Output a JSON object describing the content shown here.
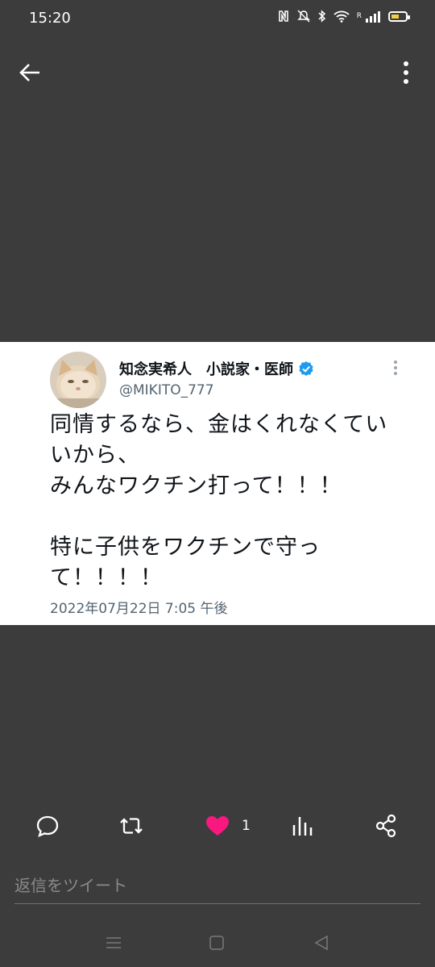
{
  "status_bar": {
    "time": "15:20",
    "icons": [
      "nfc-icon",
      "mute-icon",
      "bluetooth-icon",
      "wifi-icon",
      "roaming-label",
      "signal-icon",
      "battery-icon"
    ],
    "roaming_label": "R",
    "battery_color": "#f4d03f"
  },
  "top_bar": {
    "back_icon": "arrow-left-icon",
    "more_icon": "more-vertical-icon"
  },
  "tweet": {
    "display_name": "知念実希人　小説家・医師",
    "verified": true,
    "verified_color": "#1d9bf0",
    "handle": "@MIKITO_777",
    "text": "同情するなら、金はくれなくてい\nいから、\nみんなワクチン打って！！！\n\n特に子供をワクチンで守っ\nて！！！！",
    "date": "2022年07月22日 7:05 午後"
  },
  "actions": {
    "reply_icon": "comment-icon",
    "retweet_icon": "retweet-icon",
    "like_icon": "heart-icon",
    "like_color": "#f91880",
    "like_count": "1",
    "stats_icon": "stats-icon",
    "share_icon": "share-icon"
  },
  "reply_box": {
    "placeholder": "返信をツイート"
  },
  "nav_bar": {
    "icons": [
      "recents-icon",
      "home-icon",
      "back-icon"
    ]
  }
}
